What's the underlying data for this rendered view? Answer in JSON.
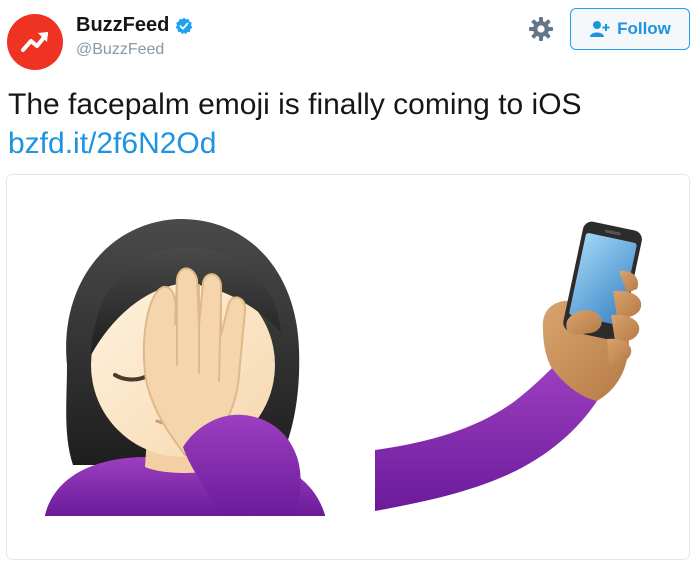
{
  "account": {
    "display_name": "BuzzFeed",
    "handle": "@BuzzFeed",
    "verified": true,
    "avatar_icon": "buzzfeed-trending-arrow-icon"
  },
  "actions": {
    "settings_icon": "gear-icon",
    "follow_label": "Follow",
    "follow_icon": "add-person-icon"
  },
  "tweet": {
    "text": "The facepalm emoji is finally coming to iOS",
    "link": "bzfd.it/2f6N2Od"
  },
  "media": {
    "left_emoji": "woman-facepalming-emoji",
    "right_emoji": "hand-holding-smartphone-emoji"
  },
  "colors": {
    "brand_red": "#ee3322",
    "link_blue": "#1c94e0",
    "purple_sleeve": "#7b1fa2"
  }
}
